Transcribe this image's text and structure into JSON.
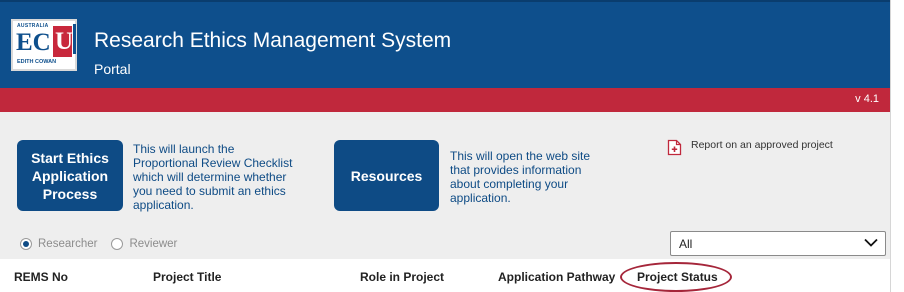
{
  "header": {
    "logo": {
      "top_text": "AUSTRALIA",
      "letters": "EC",
      "u_letter": "U",
      "bottom_text": "EDITH COWAN",
      "side_text": "UNIVERSITY"
    },
    "title": "Research Ethics Management System",
    "subtitle": "Portal",
    "colors": {
      "header_bg": "#0e4f8c",
      "accent_bar": "#c0283c"
    }
  },
  "version": "v 4.1",
  "actions": {
    "start": {
      "label": "Start Ethics Application Process",
      "description": "This will launch the Proportional Review Checklist which will determine whether you need to submit an ethics application."
    },
    "resources": {
      "label": "Resources",
      "description": "This will open the web site that provides information about completing your application."
    },
    "report": {
      "label": "Report on an approved project",
      "icon": "document-plus-icon"
    }
  },
  "role_toggle": {
    "options": [
      {
        "label": "Researcher",
        "selected": true
      },
      {
        "label": "Reviewer",
        "selected": false
      }
    ]
  },
  "filter": {
    "selected": "All",
    "icon": "chevron-down-icon"
  },
  "table": {
    "columns": [
      "REMS No",
      "Project Title",
      "Role in Project",
      "Application Pathway",
      "Project Status"
    ]
  }
}
